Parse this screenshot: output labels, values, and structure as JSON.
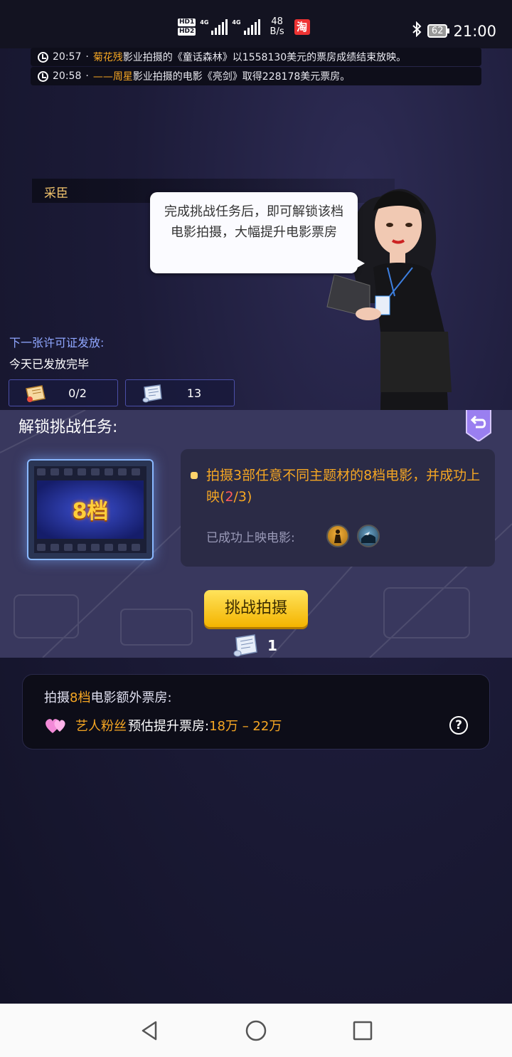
{
  "status_bar": {
    "hd1": "HD1",
    "hd2": "HD2",
    "net1": "4G",
    "net2": "4G",
    "speed_value": "48",
    "speed_unit": "B/s",
    "app_badge": "淘",
    "battery": "62",
    "time": "21:00"
  },
  "news": [
    {
      "time": "20:57",
      "sep": "·",
      "name": "菊花残",
      "text": "影业拍摄的《童话森林》以1558130美元的票房成绩结束放映。"
    },
    {
      "time": "20:58",
      "sep": "·",
      "name": "——周星",
      "text": "影业拍摄的电影《亮剑》取得228178美元票房。"
    }
  ],
  "assistant": {
    "name": "采臣",
    "speech": "完成挑战任务后，即可解锁该档电影拍摄，大幅提升电影票房"
  },
  "license": {
    "label": "下一张许可证发放:",
    "status": "今天已发放完毕",
    "permits": "0/2",
    "scrolls": "13"
  },
  "unlock": {
    "title": "解锁挑战任务:",
    "film_grade": "8档",
    "task_text": "拍摄3部任意不同主题材的8档电影，并成功上映",
    "progress_open": "(",
    "progress_current": "2",
    "progress_rest": "/3)",
    "done_label": "已成功上映电影:",
    "challenge_button": "挑战拍摄",
    "cost": "1"
  },
  "bonus": {
    "title_prefix": "拍摄",
    "title_grade": "8档",
    "title_suffix": "电影额外票房:",
    "source": "艺人粉丝",
    "label": "预估提升票房:",
    "range": "18万 – 22万",
    "help": "?"
  },
  "colors": {
    "accent_orange": "#f5a623",
    "progress_red": "#ff5b5b",
    "button_yellow": "#ffd12e",
    "label_blue": "#8fa6ff"
  }
}
